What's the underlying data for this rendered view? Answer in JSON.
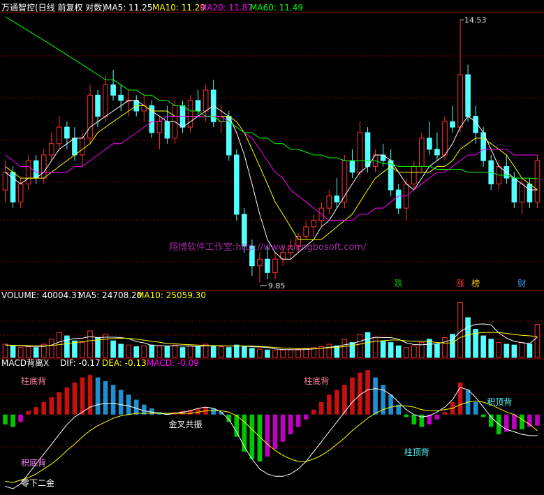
{
  "header": {
    "title": "万通智控(日线 前复权 对数)",
    "ma5": "MA5: 11.25",
    "ma10": "MA10: 11.29",
    "ma20": "MA20: 11.87",
    "ma60": "MA60: 11.49"
  },
  "volume_header": {
    "label": "VOLUME: 40004.31",
    "ma5": "MA5: 24708.20",
    "ma10": "MA10: 25059.30"
  },
  "macd_header": {
    "label": "MACD背离X",
    "dif": "DIF: -0.17",
    "dea": "DEA: -0.13",
    "macd": "MACD: -0.09"
  },
  "watermark": "翔博软件工作室:http://www.xiangbosoft.com/",
  "colors": {
    "up": "#ff3232",
    "down": "#54ffff",
    "ma5": "#ffffff",
    "ma10": "#ffff00",
    "ma20": "#ff00ff",
    "ma60": "#00ff00",
    "grid": "#8b0000",
    "macd_up_strong": "#c81010",
    "macd_up_weak": "#1e8fd0",
    "macd_down_strong": "#00c800",
    "macd_down_weak": "#c000c0"
  },
  "chart_data": {
    "type": "candlestick",
    "price_annotations": {
      "high": "14.53",
      "low": "9.85"
    },
    "price_tags": [
      {
        "text": "跌",
        "index": 51
      },
      {
        "text": "涨",
        "index": 59
      },
      {
        "text": "榜",
        "index": 61
      },
      {
        "text": "财",
        "index": 67
      }
    ],
    "macd_annotations": [
      {
        "text": "柱底背",
        "index": 3,
        "panel": "top"
      },
      {
        "text": "柱底背",
        "index": 40,
        "panel": "top"
      },
      {
        "text": "金叉共振",
        "index": 23,
        "panel": "mid"
      },
      {
        "text": "柱顶背",
        "index": 53,
        "panel": "bottom"
      },
      {
        "text": "积顶背",
        "index": 63,
        "panel": "mid"
      },
      {
        "text": "积底背",
        "index": 3,
        "panel": "bottom"
      },
      {
        "text": "零下二金",
        "index": 3,
        "panel": "zero"
      }
    ],
    "candles": [
      [
        11.3,
        11.8,
        11.1,
        11.6
      ],
      [
        11.6,
        11.7,
        11.0,
        11.1
      ],
      [
        11.1,
        11.5,
        11.0,
        11.4
      ],
      [
        11.4,
        11.9,
        11.3,
        11.8
      ],
      [
        11.8,
        11.9,
        11.4,
        11.5
      ],
      [
        11.5,
        12.0,
        11.4,
        11.9
      ],
      [
        11.9,
        12.3,
        11.8,
        12.1
      ],
      [
        12.1,
        12.6,
        12.0,
        12.4
      ],
      [
        12.4,
        12.5,
        12.0,
        12.2
      ],
      [
        12.2,
        12.4,
        11.8,
        11.9
      ],
      [
        11.9,
        12.3,
        11.7,
        12.2
      ],
      [
        12.2,
        13.2,
        12.1,
        13.0
      ],
      [
        13.0,
        13.1,
        12.4,
        12.6
      ],
      [
        12.6,
        13.4,
        12.5,
        13.2
      ],
      [
        13.2,
        13.5,
        12.9,
        13.0
      ],
      [
        13.0,
        13.2,
        12.7,
        12.9
      ],
      [
        12.9,
        13.1,
        12.6,
        12.9
      ],
      [
        12.9,
        13.0,
        12.6,
        12.7
      ],
      [
        12.7,
        13.0,
        12.5,
        12.8
      ],
      [
        12.8,
        12.9,
        12.2,
        12.3
      ],
      [
        12.3,
        12.6,
        12.0,
        12.5
      ],
      [
        12.5,
        12.8,
        12.1,
        12.2
      ],
      [
        12.2,
        12.9,
        12.1,
        12.8
      ],
      [
        12.8,
        12.9,
        12.3,
        12.4
      ],
      [
        12.4,
        13.0,
        12.3,
        12.9
      ],
      [
        12.9,
        13.1,
        12.6,
        12.7
      ],
      [
        12.7,
        13.2,
        12.5,
        13.1
      ],
      [
        13.1,
        13.3,
        12.4,
        12.5
      ],
      [
        12.5,
        12.8,
        12.3,
        12.6
      ],
      [
        12.6,
        12.7,
        11.8,
        11.9
      ],
      [
        11.9,
        12.0,
        10.8,
        10.9
      ],
      [
        10.9,
        11.0,
        10.3,
        10.4
      ],
      [
        10.4,
        10.5,
        9.95,
        10.1
      ],
      [
        10.1,
        10.3,
        9.85,
        10.2
      ],
      [
        10.2,
        10.4,
        9.9,
        10.0
      ],
      [
        10.0,
        10.3,
        9.9,
        10.2
      ],
      [
        10.2,
        10.4,
        10.1,
        10.3
      ],
      [
        10.3,
        10.5,
        10.2,
        10.4
      ],
      [
        10.4,
        10.6,
        10.3,
        10.55
      ],
      [
        10.55,
        10.8,
        10.5,
        10.7
      ],
      [
        10.7,
        10.9,
        10.55,
        10.8
      ],
      [
        10.8,
        11.1,
        10.7,
        11.0
      ],
      [
        11.0,
        11.3,
        10.9,
        11.2
      ],
      [
        11.2,
        11.5,
        11.0,
        11.1
      ],
      [
        11.1,
        11.9,
        11.0,
        11.8
      ],
      [
        11.8,
        12.0,
        11.5,
        11.6
      ],
      [
        11.6,
        12.5,
        11.5,
        12.3
      ],
      [
        12.3,
        12.4,
        11.6,
        11.7
      ],
      [
        11.7,
        12.0,
        11.6,
        11.9
      ],
      [
        11.9,
        12.1,
        11.7,
        11.8
      ],
      [
        11.8,
        12.0,
        11.2,
        11.3
      ],
      [
        11.3,
        11.4,
        10.9,
        11.0
      ],
      [
        11.0,
        11.5,
        10.8,
        11.4
      ],
      [
        11.4,
        11.8,
        11.3,
        11.7
      ],
      [
        11.7,
        12.3,
        11.6,
        12.2
      ],
      [
        12.2,
        12.5,
        11.9,
        12.0
      ],
      [
        12.0,
        12.3,
        11.8,
        11.9
      ],
      [
        11.9,
        12.6,
        11.8,
        12.5
      ],
      [
        12.5,
        12.8,
        12.3,
        12.4
      ],
      [
        12.4,
        14.53,
        12.3,
        13.4
      ],
      [
        13.4,
        13.6,
        12.5,
        12.6
      ],
      [
        12.6,
        12.8,
        12.1,
        12.3
      ],
      [
        12.3,
        12.4,
        11.7,
        11.8
      ],
      [
        11.8,
        11.9,
        11.3,
        11.4
      ],
      [
        11.4,
        11.8,
        11.3,
        11.7
      ],
      [
        11.7,
        11.9,
        11.4,
        11.5
      ],
      [
        11.5,
        11.6,
        11.0,
        11.1
      ],
      [
        11.1,
        11.5,
        10.9,
        11.4
      ],
      [
        11.4,
        11.5,
        11.0,
        11.1
      ],
      [
        11.1,
        11.9,
        11.0,
        11.8
      ]
    ],
    "ma": {
      "ma5": [
        11.6,
        11.5,
        11.4,
        11.5,
        11.5,
        11.6,
        11.8,
        12.0,
        12.1,
        12.2,
        12.2,
        12.4,
        12.5,
        12.6,
        12.7,
        12.8,
        12.9,
        12.9,
        12.8,
        12.7,
        12.6,
        12.5,
        12.5,
        12.4,
        12.5,
        12.6,
        12.7,
        12.8,
        12.7,
        12.6,
        12.3,
        11.9,
        11.4,
        10.9,
        10.5,
        10.3,
        10.2,
        10.2,
        10.3,
        10.4,
        10.5,
        10.7,
        10.8,
        11.0,
        11.2,
        11.4,
        11.6,
        11.7,
        11.9,
        11.9,
        11.8,
        11.6,
        11.4,
        11.3,
        11.5,
        11.7,
        11.8,
        11.9,
        12.1,
        12.4,
        12.6,
        12.5,
        12.3,
        12.0,
        11.7,
        11.6,
        11.5,
        11.4,
        11.3,
        11.3
      ],
      "ma10": [
        11.7,
        11.6,
        11.5,
        11.5,
        11.5,
        11.5,
        11.6,
        11.7,
        11.8,
        11.9,
        12.0,
        12.1,
        12.3,
        12.4,
        12.5,
        12.6,
        12.7,
        12.8,
        12.8,
        12.7,
        12.7,
        12.7,
        12.6,
        12.6,
        12.6,
        12.6,
        12.6,
        12.6,
        12.6,
        12.6,
        12.5,
        12.3,
        12.0,
        11.7,
        11.4,
        11.1,
        10.9,
        10.7,
        10.5,
        10.5,
        10.5,
        10.5,
        10.6,
        10.7,
        10.8,
        10.9,
        11.1,
        11.3,
        11.5,
        11.6,
        11.7,
        11.6,
        11.6,
        11.6,
        11.6,
        11.6,
        11.7,
        11.7,
        11.8,
        12.0,
        12.1,
        12.2,
        12.2,
        12.1,
        12.0,
        11.9,
        11.7,
        11.5,
        11.4,
        11.3
      ],
      "ma20": [
        11.9,
        11.8,
        11.7,
        11.7,
        11.6,
        11.6,
        11.6,
        11.6,
        11.6,
        11.7,
        11.7,
        11.8,
        11.9,
        12.0,
        12.1,
        12.1,
        12.2,
        12.3,
        12.4,
        12.5,
        12.5,
        12.6,
        12.6,
        12.6,
        12.6,
        12.6,
        12.6,
        12.6,
        12.6,
        12.5,
        12.4,
        12.3,
        12.2,
        12.0,
        11.8,
        11.6,
        11.5,
        11.3,
        11.2,
        11.1,
        11.0,
        10.9,
        10.8,
        10.8,
        10.8,
        10.8,
        10.9,
        10.9,
        11.0,
        11.0,
        11.1,
        11.2,
        11.2,
        11.3,
        11.4,
        11.5,
        11.6,
        11.6,
        11.7,
        11.8,
        11.9,
        11.9,
        12.0,
        12.0,
        12.0,
        12.0,
        11.9,
        11.9,
        11.9,
        11.9
      ],
      "ma60": [
        14.6,
        14.5,
        14.4,
        14.3,
        14.2,
        14.1,
        14.0,
        13.9,
        13.8,
        13.7,
        13.6,
        13.5,
        13.4,
        13.3,
        13.3,
        13.2,
        13.1,
        13.1,
        13.0,
        13.0,
        12.9,
        12.9,
        12.8,
        12.8,
        12.7,
        12.7,
        12.6,
        12.6,
        12.5,
        12.5,
        12.4,
        12.3,
        12.3,
        12.2,
        12.2,
        12.1,
        12.1,
        12.0,
        12.0,
        11.95,
        11.9,
        11.9,
        11.85,
        11.85,
        11.8,
        11.8,
        11.8,
        11.8,
        11.8,
        11.75,
        11.75,
        11.7,
        11.7,
        11.7,
        11.7,
        11.7,
        11.65,
        11.65,
        11.65,
        11.65,
        11.6,
        11.6,
        11.6,
        11.6,
        11.55,
        11.55,
        11.5,
        11.5,
        11.5,
        11.49
      ]
    },
    "volume": [
      16000,
      14000,
      12000,
      13000,
      12000,
      16000,
      22000,
      30000,
      26000,
      20000,
      18000,
      32000,
      24000,
      28000,
      20000,
      16000,
      15000,
      13000,
      14000,
      15000,
      14000,
      13000,
      15000,
      12000,
      14000,
      13000,
      16000,
      14000,
      13000,
      12000,
      15000,
      13000,
      11000,
      10000,
      9000,
      8500,
      9000,
      9500,
      10000,
      11000,
      12000,
      13000,
      16000,
      14000,
      22000,
      18000,
      28000,
      30000,
      24000,
      20000,
      18000,
      14000,
      12000,
      14000,
      18000,
      22000,
      16000,
      24000,
      28000,
      66000,
      48000,
      34000,
      26000,
      22000,
      18000,
      16000,
      15000,
      18000,
      16000,
      40004
    ],
    "volume_ma": {
      "ma5": [
        15000,
        14500,
        14000,
        13500,
        13400,
        13400,
        15000,
        18600,
        21200,
        22800,
        23200,
        25200,
        24000,
        24400,
        24400,
        24000,
        22600,
        19200,
        17600,
        14600,
        14200,
        13800,
        14200,
        13800,
        13600,
        13400,
        14000,
        14000,
        14000,
        13600,
        14000,
        13600,
        13000,
        12600,
        12000,
        10300,
        9600,
        9300,
        9300,
        9600,
        10300,
        11100,
        12400,
        13200,
        15400,
        16600,
        19600,
        22400,
        24400,
        24000,
        24000,
        22000,
        17600,
        15600,
        15200,
        16000,
        16400,
        18800,
        21600,
        31200,
        36400,
        40000,
        40400,
        39200,
        29600,
        23200,
        19400,
        17800,
        16600,
        24700
      ],
      "ma10": [
        15000,
        14700,
        14400,
        14200,
        14000,
        14000,
        14300,
        15500,
        16700,
        18000,
        19000,
        20200,
        21100,
        22000,
        22600,
        23200,
        23000,
        22000,
        20800,
        19500,
        18400,
        16600,
        16400,
        15800,
        15300,
        15000,
        14600,
        14200,
        14000,
        13900,
        13800,
        13800,
        13600,
        13300,
        12800,
        12000,
        11400,
        11000,
        10600,
        10500,
        10600,
        11000,
        11600,
        12200,
        13200,
        14300,
        16100,
        17900,
        19400,
        20100,
        21000,
        21000,
        20000,
        19600,
        19700,
        19100,
        18100,
        17300,
        17500,
        24100,
        27300,
        29100,
        30000,
        30300,
        30000,
        29000,
        27800,
        26800,
        26100,
        25059
      ]
    },
    "macd": {
      "hist": [
        -0.08,
        -0.1,
        -0.06,
        0.03,
        0.06,
        0.1,
        0.14,
        0.18,
        0.22,
        0.26,
        0.3,
        0.32,
        0.3,
        0.27,
        0.24,
        0.2,
        0.16,
        0.12,
        0.08,
        0.05,
        0.02,
        0.01,
        0.02,
        0.03,
        0.04,
        0.05,
        0.06,
        0.05,
        0.02,
        -0.06,
        -0.18,
        -0.3,
        -0.36,
        -0.38,
        -0.34,
        -0.28,
        -0.22,
        -0.16,
        -0.1,
        -0.04,
        0.04,
        0.1,
        0.16,
        0.2,
        0.24,
        0.3,
        0.34,
        0.36,
        0.3,
        0.24,
        0.16,
        0.08,
        -0.02,
        -0.08,
        -0.1,
        -0.08,
        -0.04,
        0.02,
        0.1,
        0.26,
        0.2,
        0.1,
        -0.02,
        -0.1,
        -0.16,
        -0.14,
        -0.12,
        -0.12,
        -0.1,
        -0.09
      ],
      "dif": [
        -0.58,
        -0.6,
        -0.56,
        -0.48,
        -0.4,
        -0.32,
        -0.24,
        -0.16,
        -0.08,
        -0.02,
        0.02,
        0.06,
        0.08,
        0.09,
        0.09,
        0.08,
        0.07,
        0.05,
        0.03,
        0.02,
        0.01,
        0.0,
        0.01,
        0.02,
        0.03,
        0.05,
        0.06,
        0.05,
        0.02,
        -0.04,
        -0.14,
        -0.26,
        -0.36,
        -0.44,
        -0.48,
        -0.5,
        -0.5,
        -0.48,
        -0.44,
        -0.38,
        -0.3,
        -0.22,
        -0.14,
        -0.06,
        0.02,
        0.1,
        0.16,
        0.2,
        0.21,
        0.2,
        0.16,
        0.1,
        0.04,
        0.0,
        -0.02,
        -0.01,
        0.02,
        0.06,
        0.12,
        0.22,
        0.2,
        0.14,
        0.06,
        -0.02,
        -0.08,
        -0.12,
        -0.14,
        -0.16,
        -0.17,
        -0.17
      ],
      "dea": [
        -0.54,
        -0.55,
        -0.53,
        -0.51,
        -0.48,
        -0.44,
        -0.4,
        -0.35,
        -0.29,
        -0.24,
        -0.18,
        -0.13,
        -0.09,
        -0.06,
        -0.03,
        -0.01,
        0.0,
        0.01,
        0.01,
        0.01,
        0.01,
        0.01,
        0.01,
        0.01,
        0.01,
        0.02,
        0.03,
        0.03,
        0.03,
        0.02,
        -0.01,
        -0.06,
        -0.12,
        -0.18,
        -0.24,
        -0.29,
        -0.33,
        -0.36,
        -0.38,
        -0.38,
        -0.36,
        -0.33,
        -0.29,
        -0.24,
        -0.19,
        -0.13,
        -0.08,
        -0.03,
        0.01,
        0.04,
        0.06,
        0.07,
        0.07,
        0.06,
        0.04,
        0.03,
        0.03,
        0.04,
        0.05,
        0.08,
        0.1,
        0.11,
        0.1,
        0.08,
        0.05,
        0.02,
        0.0,
        -0.04,
        -0.08,
        -0.13
      ]
    }
  }
}
